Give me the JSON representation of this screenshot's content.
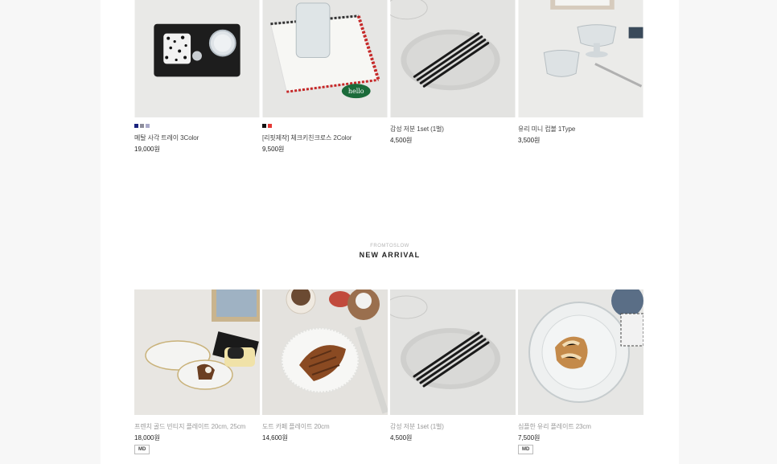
{
  "colors": {
    "background": "#f7f7f7",
    "panel": "#ffffff",
    "swatch_navy": "#1a237e",
    "swatch_grey": "#8d8d9a",
    "swatch_lilac": "#a9a9c9",
    "swatch_black": "#111111",
    "swatch_red": "#e53935"
  },
  "top_products": [
    {
      "name": "메탈 사각 트레이 3Color",
      "price": "19,000원",
      "swatches": [
        "#1a237e",
        "#8d8d9a",
        "#a9a9c9"
      ]
    },
    {
      "name": "[리핏제작] 체크키친크로스 2Color",
      "price": "9,500원",
      "swatches": [
        "#111111",
        "#e53935"
      ]
    },
    {
      "name": "감성 저분 1set (1벌)",
      "price": "4,500원",
      "swatches": []
    },
    {
      "name": "유리 미니 컵볼 1Type",
      "price": "3,500원",
      "swatches": []
    }
  ],
  "section": {
    "subtitle": "FROMTOSLOW",
    "title": "NEW ARRIVAL"
  },
  "new_products": [
    {
      "name": "프렌치 골드 빈티지 플레이트 20cm, 25cm",
      "price": "18,000원",
      "badge": "MD"
    },
    {
      "name": "도트 카페 플레이트 20cm",
      "price": "14,600원",
      "badge": ""
    },
    {
      "name": "감성 저분 1set (1벌)",
      "price": "4,500원",
      "badge": ""
    },
    {
      "name": "심플한 유리 플레이트 23cm",
      "price": "7,500원",
      "badge": "MD"
    }
  ]
}
